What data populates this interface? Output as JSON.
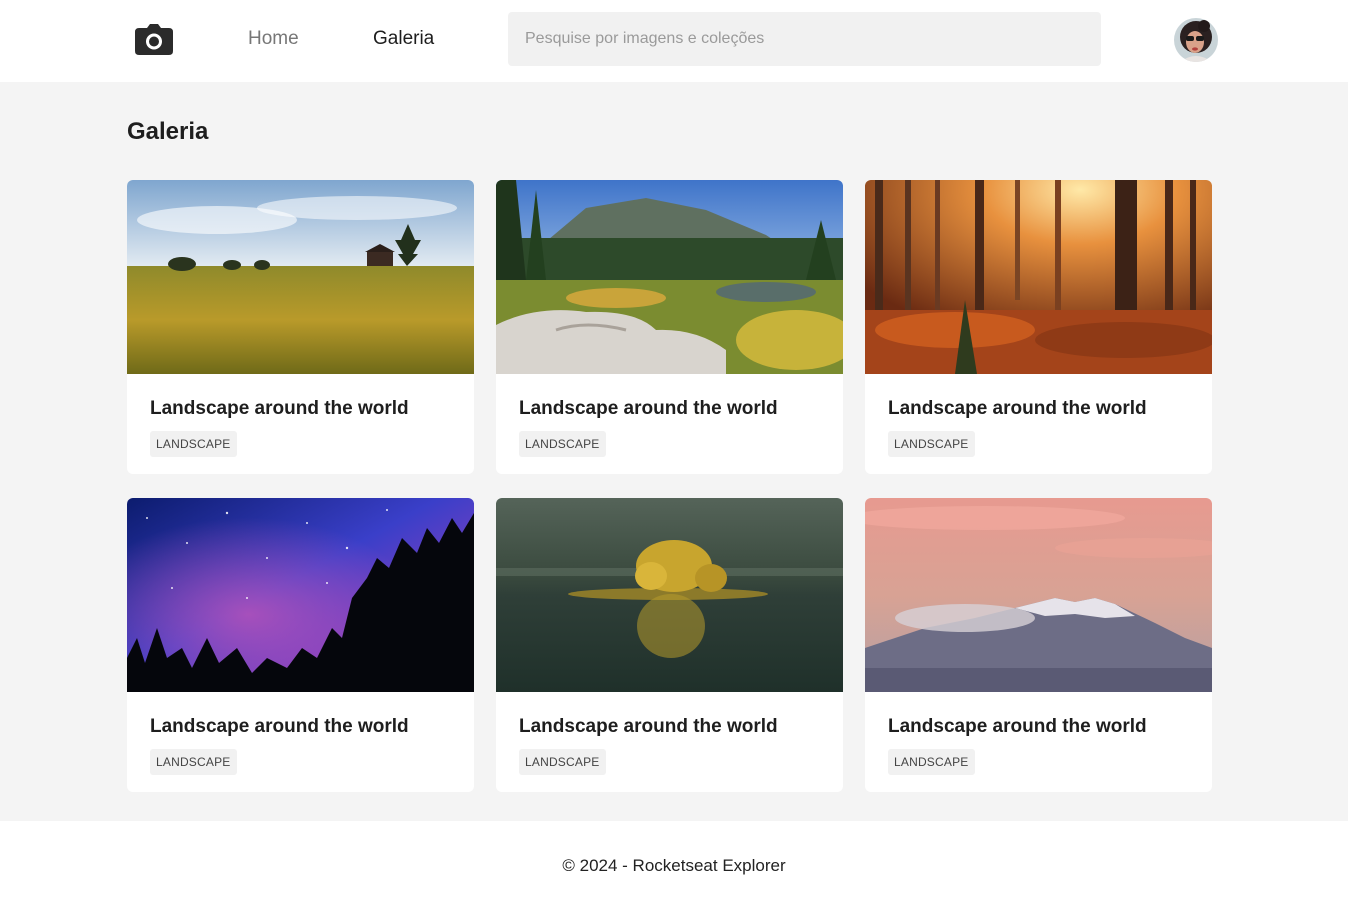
{
  "header": {
    "logo_icon": "camera-icon",
    "nav": [
      {
        "label": "Home",
        "active": false
      },
      {
        "label": "Galeria",
        "active": true
      }
    ],
    "search": {
      "placeholder": "Pesquise por imagens e coleções",
      "value": ""
    },
    "avatar_icon": "user-avatar"
  },
  "main": {
    "title": "Galeria",
    "cards": [
      {
        "title": "Landscape around the world",
        "tag": "LANDSCAPE"
      },
      {
        "title": "Landscape around the world",
        "tag": "LANDSCAPE"
      },
      {
        "title": "Landscape around the world",
        "tag": "LANDSCAPE"
      },
      {
        "title": "Landscape around the world",
        "tag": "LANDSCAPE"
      },
      {
        "title": "Landscape around the world",
        "tag": "LANDSCAPE"
      },
      {
        "title": "Landscape around the world",
        "tag": "LANDSCAPE"
      }
    ]
  },
  "footer": {
    "text": "© 2024 - Rocketseat Explorer"
  }
}
